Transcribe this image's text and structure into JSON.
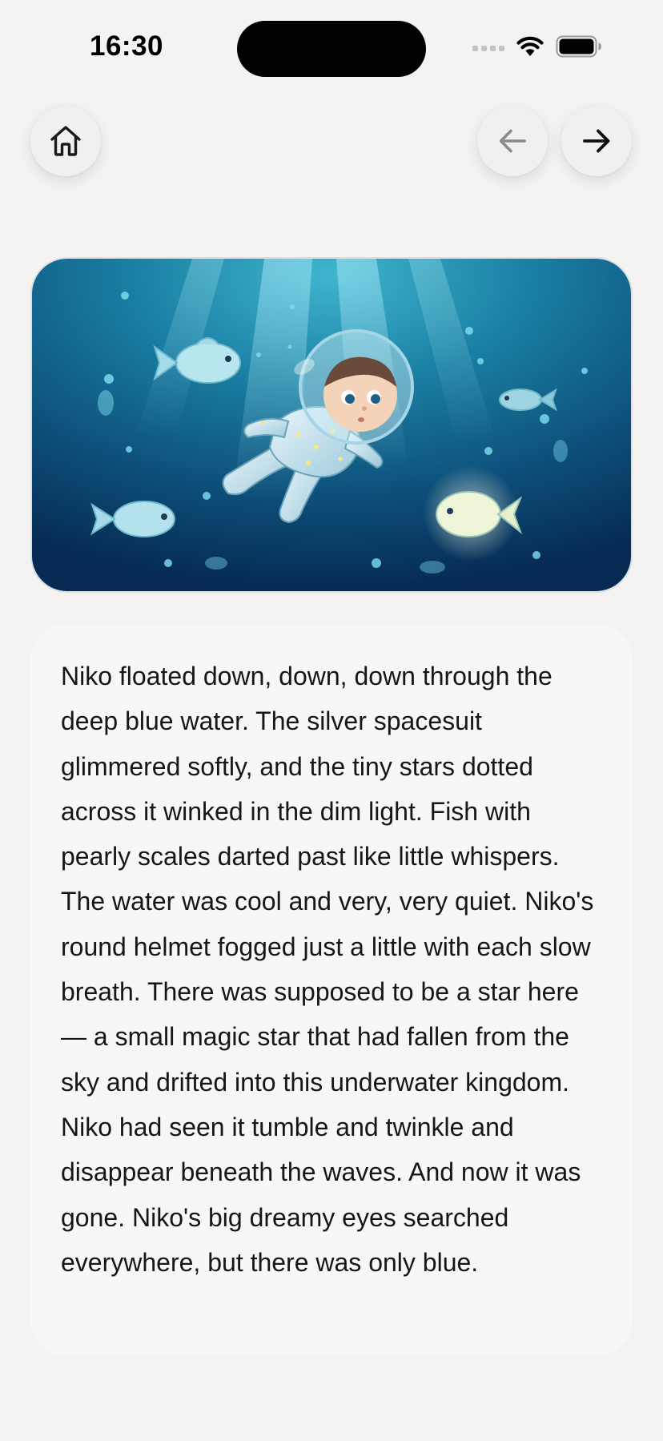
{
  "status_bar": {
    "time": "16:30",
    "icons": [
      "cellular-signal-icon",
      "wifi-icon",
      "battery-icon"
    ]
  },
  "nav": {
    "home_icon": "home-icon",
    "back_icon": "arrow-left-icon",
    "forward_icon": "arrow-right-icon"
  },
  "illustration": {
    "subject": "child-astronaut-underwater-with-fish"
  },
  "story": {
    "text": "Niko floated down, down, down through the deep blue water. The silver spacesuit glimmered softly, and the tiny stars dotted across it winked in the dim light. Fish with pearly scales darted past like little whispers. The water was cool and very, very quiet. Niko's round helmet fogged just a little with each slow breath. There was supposed to be a star here — a small magic star that had fallen from the sky and drifted into this underwater kingdom. Niko had seen it tumble and twinkle and disappear beneath the waves. And now it was gone. Niko's big dreamy eyes searched everywhere, but there was only blue."
  },
  "colors": {
    "background": "#f4f3f2",
    "card": "#f8f7f6",
    "text": "#161616",
    "water_dark": "#06254a",
    "water_light": "#1e8fb0"
  }
}
